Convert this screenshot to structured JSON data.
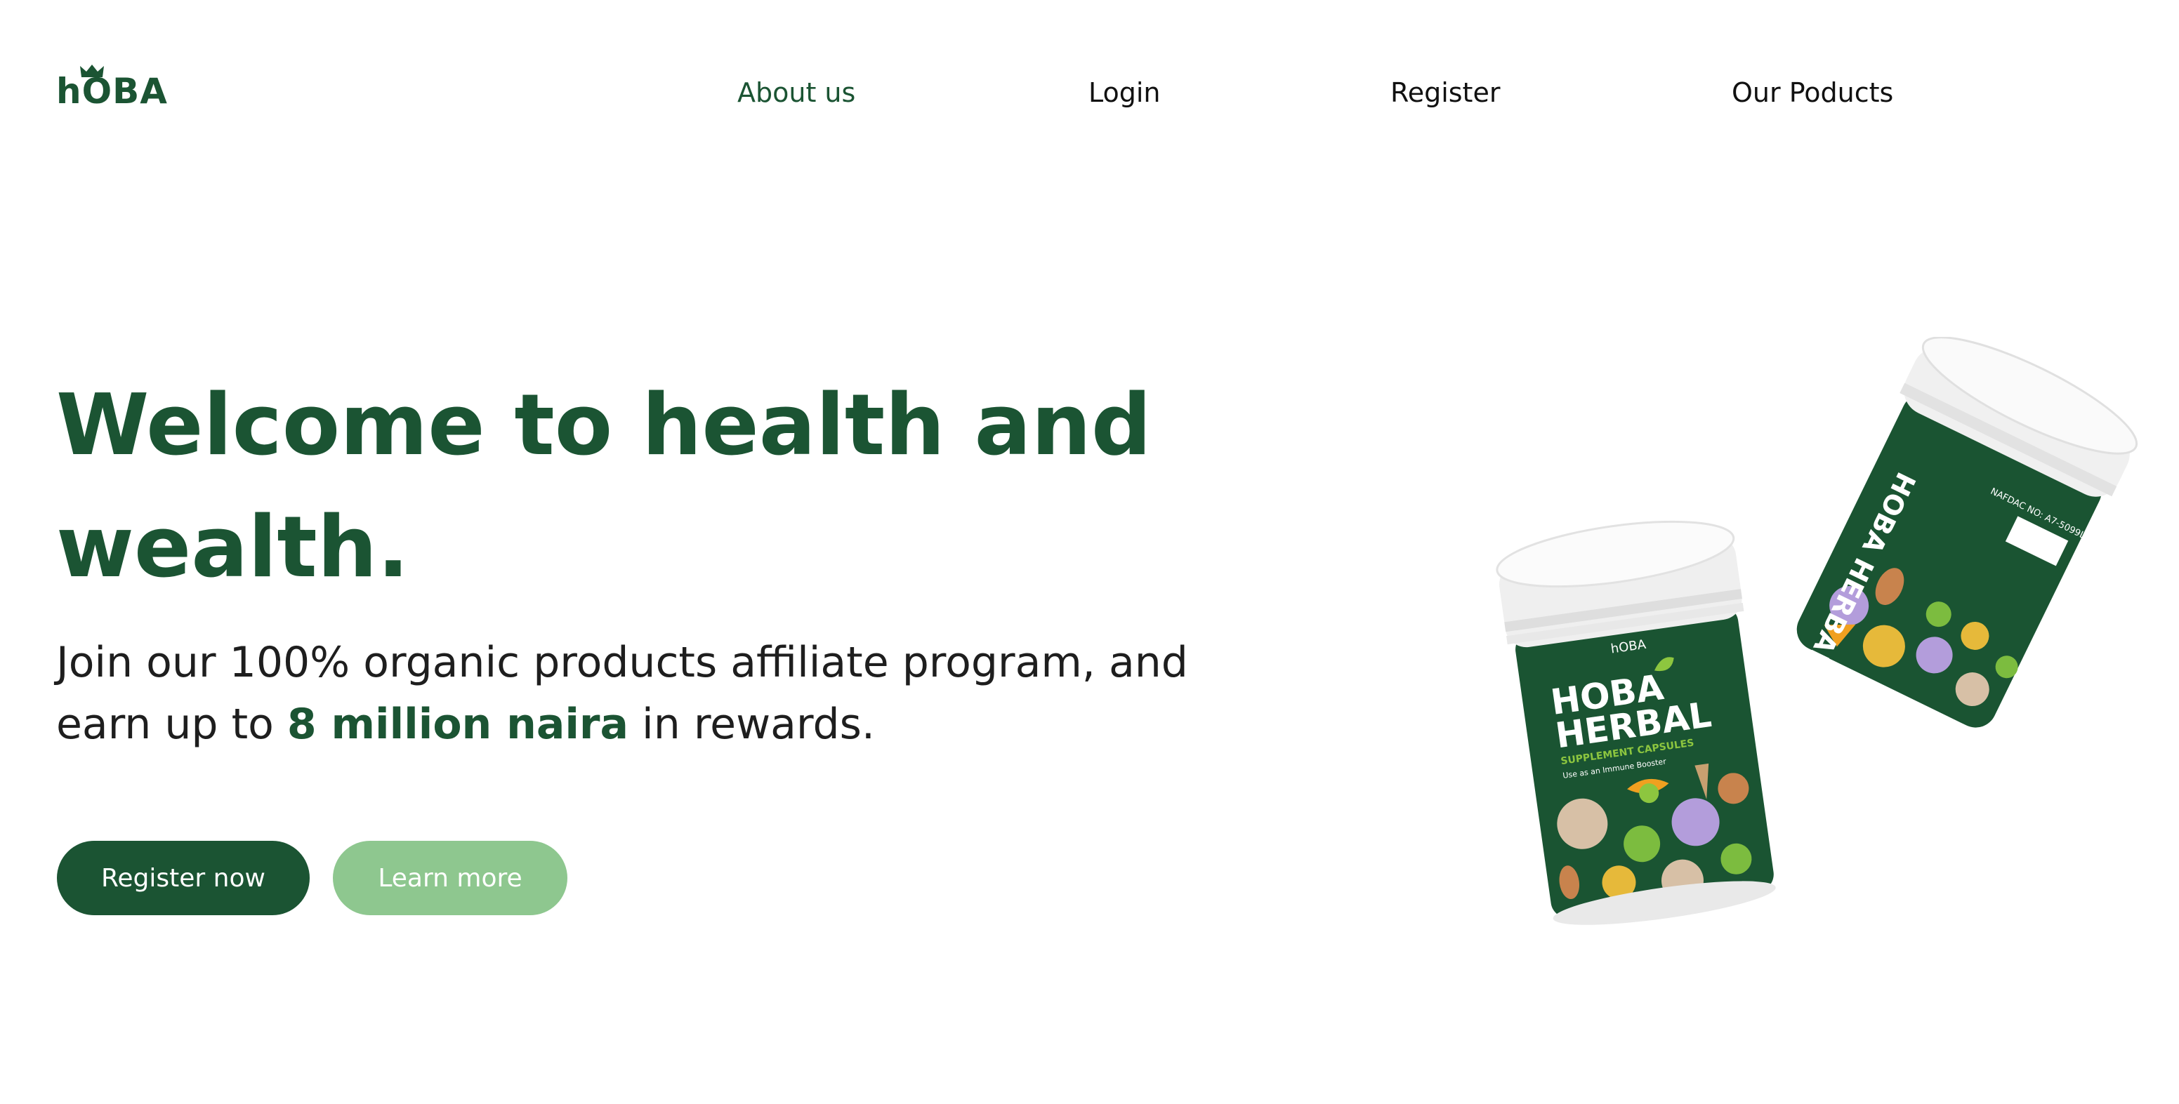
{
  "brand": {
    "logo_text": "hOBA"
  },
  "nav": {
    "items": [
      {
        "label": "About us",
        "active": true
      },
      {
        "label": "Login"
      },
      {
        "label": "Register"
      },
      {
        "label": "Our Poducts"
      }
    ]
  },
  "hero": {
    "headline": "Welcome to health and wealth.",
    "subtext_before": "Join our 100% organic products affiliate program, and earn up to ",
    "subtext_highlight": "8 million naira",
    "subtext_after": " in rewards.",
    "primary_button": "Register now",
    "secondary_button": "Learn more"
  },
  "product_image": {
    "jar1_brand": "hOBA",
    "jar1_title_line1": "HOBA",
    "jar1_title_line2": "HERBAL",
    "jar1_subtitle": "SUPPLEMENT CAPSULES",
    "jar1_tagline": "Use as an Immune Booster",
    "jar2_label": "NAFDAC NO: A7-5099L",
    "jar2_side_text": "HOBA HERBAL"
  },
  "colors": {
    "brand_green": "#1b5433",
    "light_green": "#8ec78f",
    "text_dark": "#111111",
    "background": "#ffffff"
  }
}
